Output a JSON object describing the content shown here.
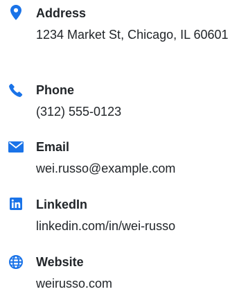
{
  "accent_color": "#1a73e8",
  "contacts": [
    {
      "icon": "map-pin-icon",
      "label": "Address",
      "value": "1234 Market St, Chicago, IL 60601"
    },
    {
      "icon": "phone-icon",
      "label": "Phone",
      "value": "(312) 555-0123"
    },
    {
      "icon": "envelope-icon",
      "label": "Email",
      "value": "wei.russo@example.com"
    },
    {
      "icon": "linkedin-icon",
      "label": "LinkedIn",
      "value": "linkedin.com/in/wei-russo"
    },
    {
      "icon": "globe-icon",
      "label": "Website",
      "value": "weirusso.com"
    }
  ]
}
